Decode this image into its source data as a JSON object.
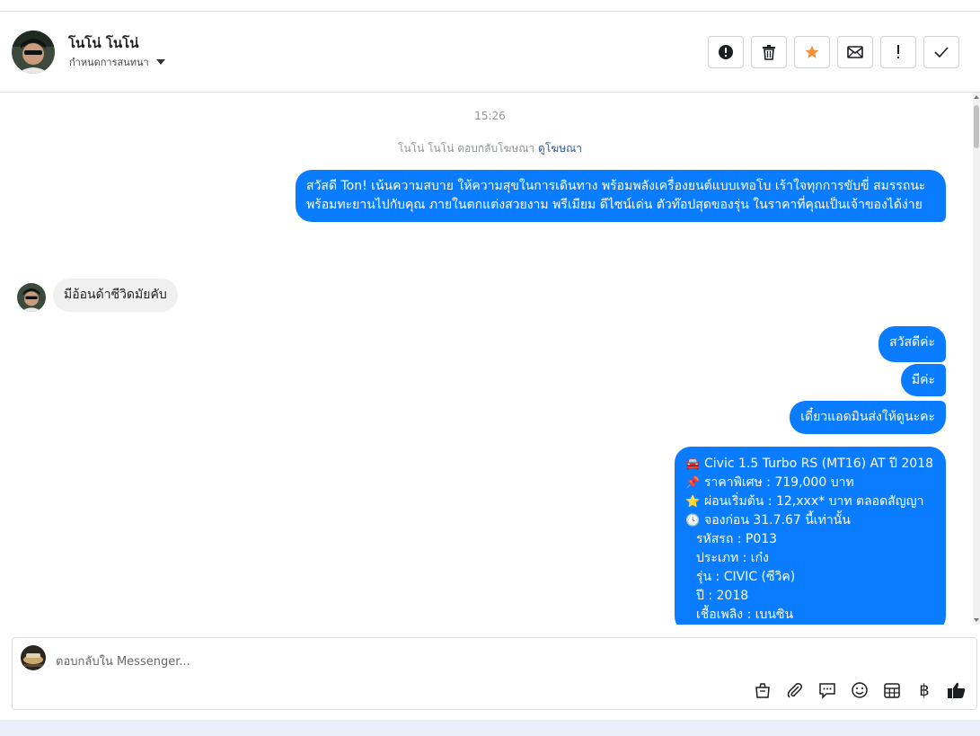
{
  "header": {
    "contact_name": "โนโน่ โนโน่",
    "assign_label": "กำหนดการสนทนา"
  },
  "actions": [
    {
      "name": "report-button",
      "icon": "exclamation-circle-icon"
    },
    {
      "name": "delete-button",
      "icon": "trash-icon"
    },
    {
      "name": "star-button",
      "icon": "star-icon",
      "color": "#f7923b"
    },
    {
      "name": "mark-unread-button",
      "icon": "envelope-icon"
    },
    {
      "name": "follow-up-button",
      "icon": "exclamation-icon"
    },
    {
      "name": "mark-done-button",
      "icon": "check-icon"
    }
  ],
  "chat": {
    "timestamp": "15:26",
    "ad_reply_prefix": "โนโน่ โนโน่ ตอบกลับโฆษณา",
    "ad_reply_link": "ดูโฆษณา",
    "messages": {
      "m1": "สวัสดี Ton! เน้นความสบาย ให้ความสุขในการเดินทาง พร้อมพลังเครื่องยนต์แบบเทอโบ เร้าใจทุกการขับขี่ สมรรถนะพร้อมทะยานไปกับคุณ ภายในตกแต่งสวยงาม พรีเมียม ดีไซน์เด่น ตัวท๊อปสุดของรุ่น ในราคาที่คุณเป็นเจ้าของได้ง่าย",
      "m2": "มีอ้อนด้าซีวิดมัยคับ",
      "m3": "สวัสดีค่ะ",
      "m4": "มีค่ะ",
      "m5": "เดี๋ยวแอดมินส่งให้ดูนะคะ",
      "m6": [
        {
          "emoji": "🚘",
          "text": "Civic 1.5 Turbo RS (MT16) AT ปี 2018"
        },
        {
          "emoji": "📌",
          "text": "ราคาพิเศษ : 719,000 บาท"
        },
        {
          "emoji": "⭐",
          "text": "ผ่อนเริ่มต้น : 12,xxx* บาท ตลอดสัญญา"
        },
        {
          "emoji": "🕓",
          "text": "จองก่อน 31.7.67 นี้เท่านั้น"
        },
        {
          "emoji": "",
          "text": "รหัสรถ : P013"
        },
        {
          "emoji": "",
          "text": "ประเภท : เก๋ง"
        },
        {
          "emoji": "",
          "text": "รุ่น : CIVIC (ซีวิค)"
        },
        {
          "emoji": "",
          "text": "ปี : 2018"
        },
        {
          "emoji": "",
          "text": "เชื้อเพลิง : เบนซิน"
        }
      ]
    }
  },
  "composer": {
    "placeholder": "ตอบกลับใน Messenger..."
  },
  "tools": [
    {
      "name": "shop-bag-icon"
    },
    {
      "name": "attachment-icon"
    },
    {
      "name": "saved-reply-icon"
    },
    {
      "name": "emoji-icon"
    },
    {
      "name": "calendar-icon"
    },
    {
      "name": "baht-icon",
      "label": "฿"
    },
    {
      "name": "like-icon"
    }
  ],
  "colors": {
    "accent": "#0a7cff",
    "star": "#f7923b"
  }
}
